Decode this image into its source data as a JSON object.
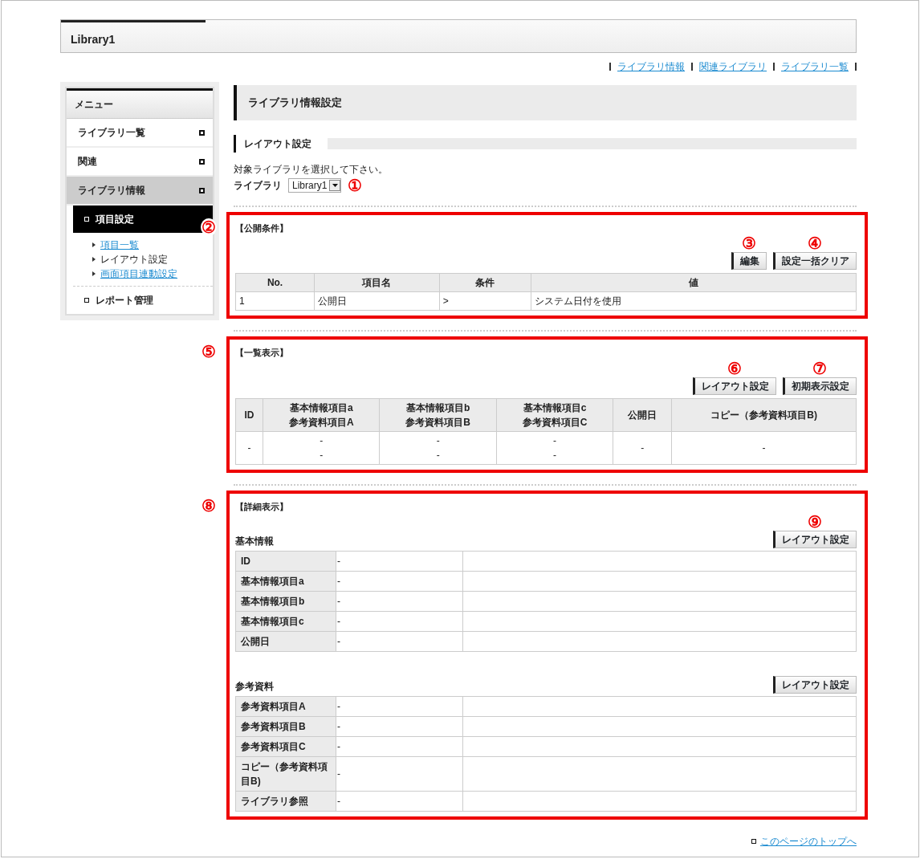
{
  "header": {
    "title": "Library1"
  },
  "top_links": [
    "ライブラリ情報",
    "関連ライブラリ",
    "ライブラリ一覧"
  ],
  "sidebar": {
    "title": "メニュー",
    "items": [
      {
        "label": "ライブラリ一覧",
        "selected": false
      },
      {
        "label": "関連",
        "selected": false
      },
      {
        "label": "ライブラリ情報",
        "selected": true,
        "children": [
          {
            "label": "項目設定",
            "selected": true,
            "children": [
              {
                "label": "項目一覧",
                "selected": false
              },
              {
                "label": "レイアウト設定",
                "selected": true
              },
              {
                "label": "画面項目連動設定",
                "selected": false
              }
            ]
          },
          {
            "label": "レポート管理",
            "selected": false
          }
        ]
      }
    ]
  },
  "page_title": "ライブラリ情報設定",
  "subheading": "レイアウト設定",
  "instruction": "対象ライブラリを選択して下さい。",
  "library_select": {
    "label": "ライブラリ",
    "value": "Library1",
    "callout": "①"
  },
  "sections": [
    {
      "kind": "conditions",
      "callout": "②",
      "title": "【公開条件】",
      "buttons": [
        {
          "label": "編集",
          "callout": "③"
        },
        {
          "label": "設定一括クリア",
          "callout": "④"
        }
      ],
      "columns": [
        "No.",
        "項目名",
        "条件",
        "値"
      ],
      "rows": [
        [
          "1",
          "公開日",
          ">",
          "システム日付を使用"
        ]
      ]
    },
    {
      "kind": "list",
      "callout": "⑤",
      "title": "【一覧表示】",
      "buttons": [
        {
          "label": "レイアウト設定",
          "callout": "⑥"
        },
        {
          "label": "初期表示設定",
          "callout": "⑦"
        }
      ],
      "columns": [
        "ID",
        "基本情報項目a\n参考資料項目A",
        "基本情報項目b\n参考資料項目B",
        "基本情報項目c\n参考資料項目C",
        "公開日",
        "コピー（参考資料項目B)"
      ],
      "rows": [
        [
          "-",
          "-\n-",
          "-\n-",
          "-\n-",
          "-",
          "-"
        ]
      ]
    },
    {
      "kind": "detail",
      "callout": "⑧",
      "title": "【詳細表示】",
      "groups": [
        {
          "heading": "基本情報",
          "button": {
            "label": "レイアウト設定",
            "callout": "⑨"
          },
          "rows": [
            {
              "label": "ID",
              "value": "-"
            },
            {
              "label": "基本情報項目a",
              "value": "-"
            },
            {
              "label": "基本情報項目b",
              "value": "-"
            },
            {
              "label": "基本情報項目c",
              "value": "-"
            },
            {
              "label": "公開日",
              "value": "-"
            }
          ]
        },
        {
          "heading": "参考資料",
          "button": {
            "label": "レイアウト設定"
          },
          "rows": [
            {
              "label": "参考資料項目A",
              "value": "-"
            },
            {
              "label": "参考資料項目B",
              "value": "-"
            },
            {
              "label": "参考資料項目C",
              "value": "-"
            },
            {
              "label": "コピー（参考資料項目B)",
              "value": "-"
            },
            {
              "label": "ライブラリ参照",
              "value": "-"
            }
          ]
        }
      ]
    }
  ],
  "footer_link": "このページのトップへ"
}
